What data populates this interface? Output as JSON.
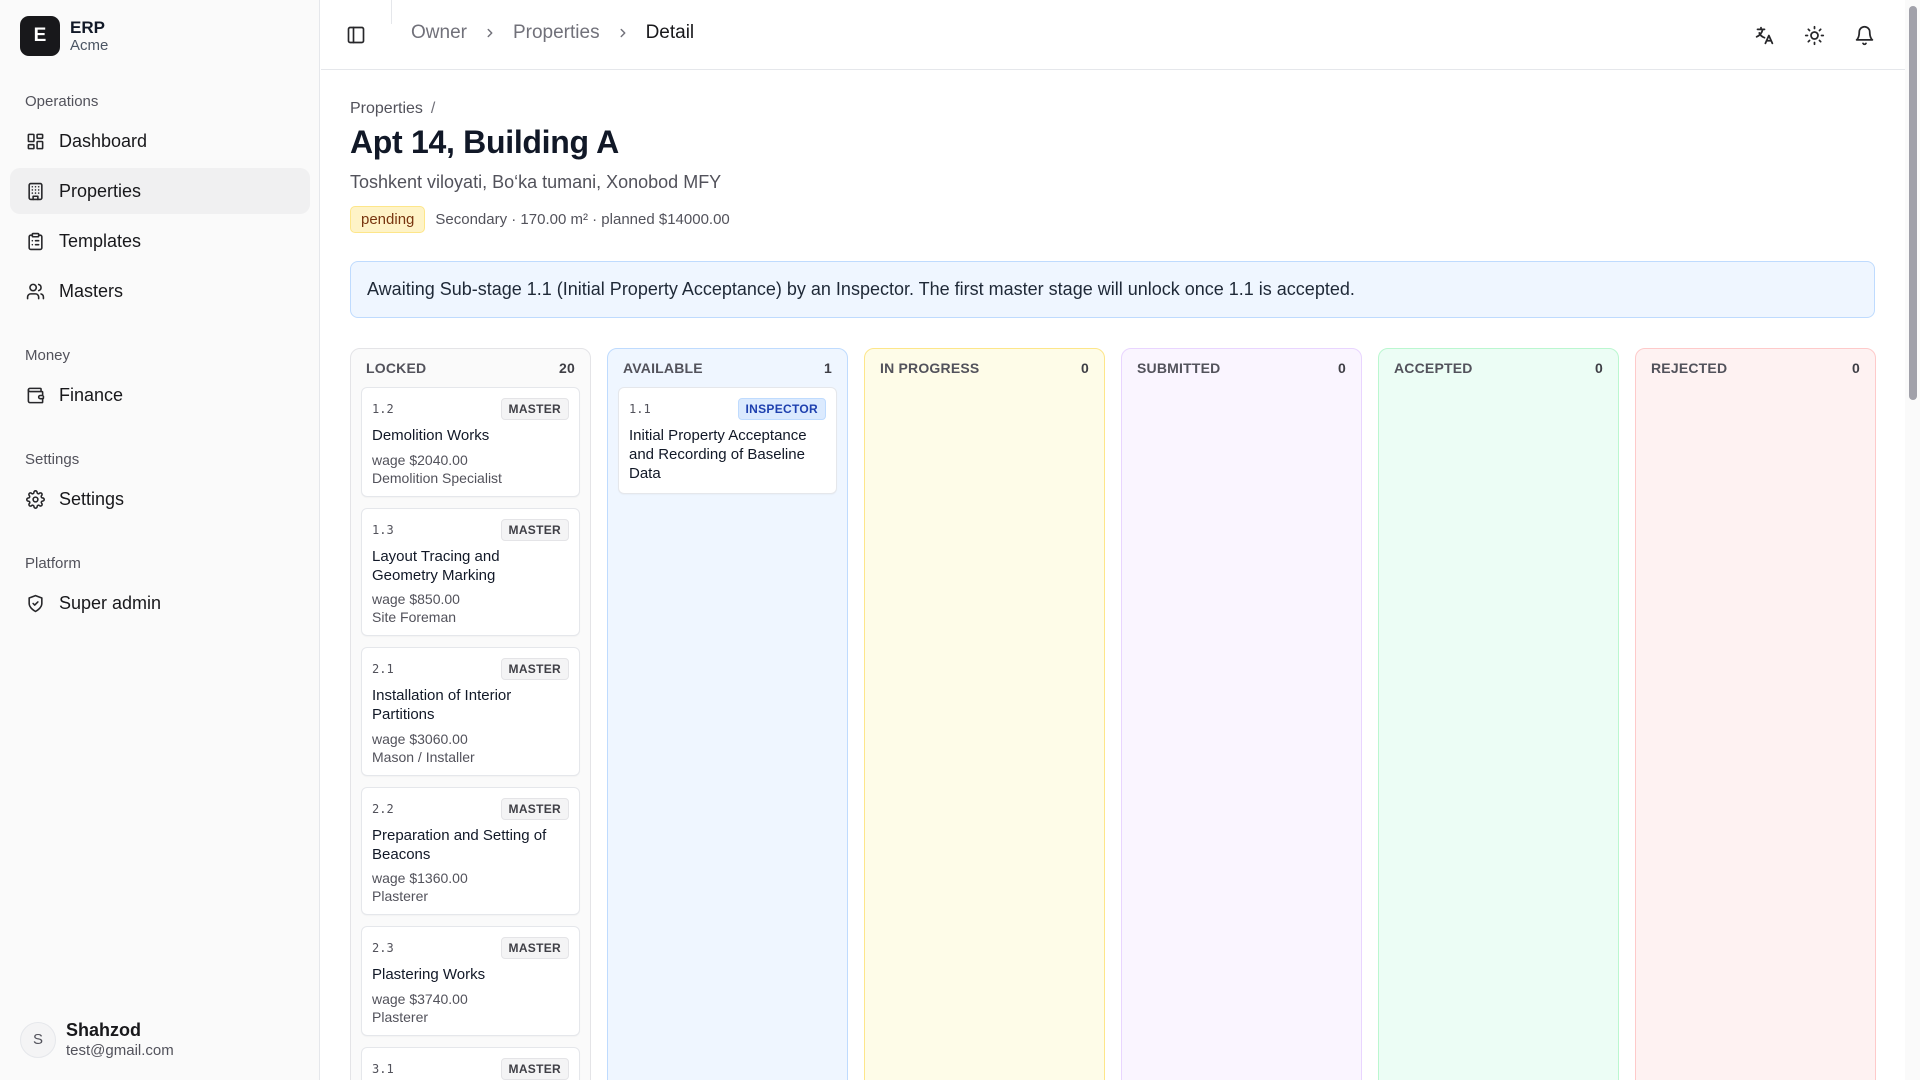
{
  "brand": {
    "initial": "E",
    "name": "ERP",
    "org": "Acme"
  },
  "sidebar": {
    "groups": [
      {
        "label": "Operations",
        "items": [
          {
            "label": "Dashboard",
            "icon": "dashboard-icon"
          },
          {
            "label": "Properties",
            "icon": "building-icon",
            "active": true
          },
          {
            "label": "Templates",
            "icon": "clipboard-icon"
          },
          {
            "label": "Masters",
            "icon": "users-icon"
          }
        ]
      },
      {
        "label": "Money",
        "items": [
          {
            "label": "Finance",
            "icon": "wallet-icon"
          }
        ]
      },
      {
        "label": "Settings",
        "items": [
          {
            "label": "Settings",
            "icon": "gear-icon"
          }
        ]
      },
      {
        "label": "Platform",
        "items": [
          {
            "label": "Super admin",
            "icon": "shield-check-icon"
          }
        ]
      }
    ]
  },
  "user": {
    "initial": "S",
    "name": "Shahzod",
    "email": "test@gmail.com"
  },
  "topbar": {
    "breadcrumbs": [
      "Owner",
      "Properties",
      "Detail"
    ]
  },
  "page": {
    "mini_crumb": "Properties",
    "mini_crumb_sep": "/",
    "title": "Apt 14, Building A",
    "address": "Toshkent viloyati, Bo‘ka tumani, Xonobod MFY",
    "status": "pending",
    "meta": "Secondary · 170.00 m² · planned $14000.00",
    "alert": "Awaiting Sub-stage 1.1 (Initial Property Acceptance) by an Inspector. The first master stage will unlock once 1.1 is accepted."
  },
  "colors": {
    "locked_bg": "#fafafa",
    "locked_border": "#e4e4e7",
    "available_bg": "#eff6ff",
    "available_border": "#bfdbfe",
    "in_progress_bg": "#fefce8",
    "in_progress_border": "#fde68a",
    "submitted_bg": "#faf5ff",
    "submitted_border": "#e9d5ff",
    "accepted_bg": "#ecfdf5",
    "accepted_border": "#bbf7d0",
    "rejected_bg": "#fef2f2",
    "rejected_border": "#fecaca"
  },
  "board": {
    "columns": [
      {
        "key": "locked",
        "label": "LOCKED",
        "count": "20",
        "cards": [
          {
            "code": "1.2",
            "tag": "MASTER",
            "title": "Demolition Works",
            "wage": "wage $2040.00",
            "role": "Demolition Specialist"
          },
          {
            "code": "1.3",
            "tag": "MASTER",
            "title": "Layout Tracing and Geometry Marking",
            "wage": "wage $850.00",
            "role": "Site Foreman"
          },
          {
            "code": "2.1",
            "tag": "MASTER",
            "title": "Installation of Interior Partitions",
            "wage": "wage $3060.00",
            "role": "Mason / Installer"
          },
          {
            "code": "2.2",
            "tag": "MASTER",
            "title": "Preparation and Setting of Beacons",
            "wage": "wage $1360.00",
            "role": "Plasterer"
          },
          {
            "code": "2.3",
            "tag": "MASTER",
            "title": "Plastering Works",
            "wage": "wage $3740.00",
            "role": "Plasterer"
          },
          {
            "code": "3.1",
            "tag": "MASTER",
            "title": "",
            "wage": "",
            "role": ""
          }
        ]
      },
      {
        "key": "available",
        "label": "AVAILABLE",
        "count": "1",
        "cards": [
          {
            "code": "1.1",
            "tag": "INSPECTOR",
            "title": "Initial Property Acceptance and Recording of Baseline Data",
            "wage": "",
            "role": ""
          }
        ]
      },
      {
        "key": "in_progress",
        "label": "IN PROGRESS",
        "count": "0",
        "cards": []
      },
      {
        "key": "submitted",
        "label": "SUBMITTED",
        "count": "0",
        "cards": []
      },
      {
        "key": "accepted",
        "label": "ACCEPTED",
        "count": "0",
        "cards": []
      },
      {
        "key": "rejected",
        "label": "REJECTED",
        "count": "0",
        "cards": []
      }
    ]
  }
}
